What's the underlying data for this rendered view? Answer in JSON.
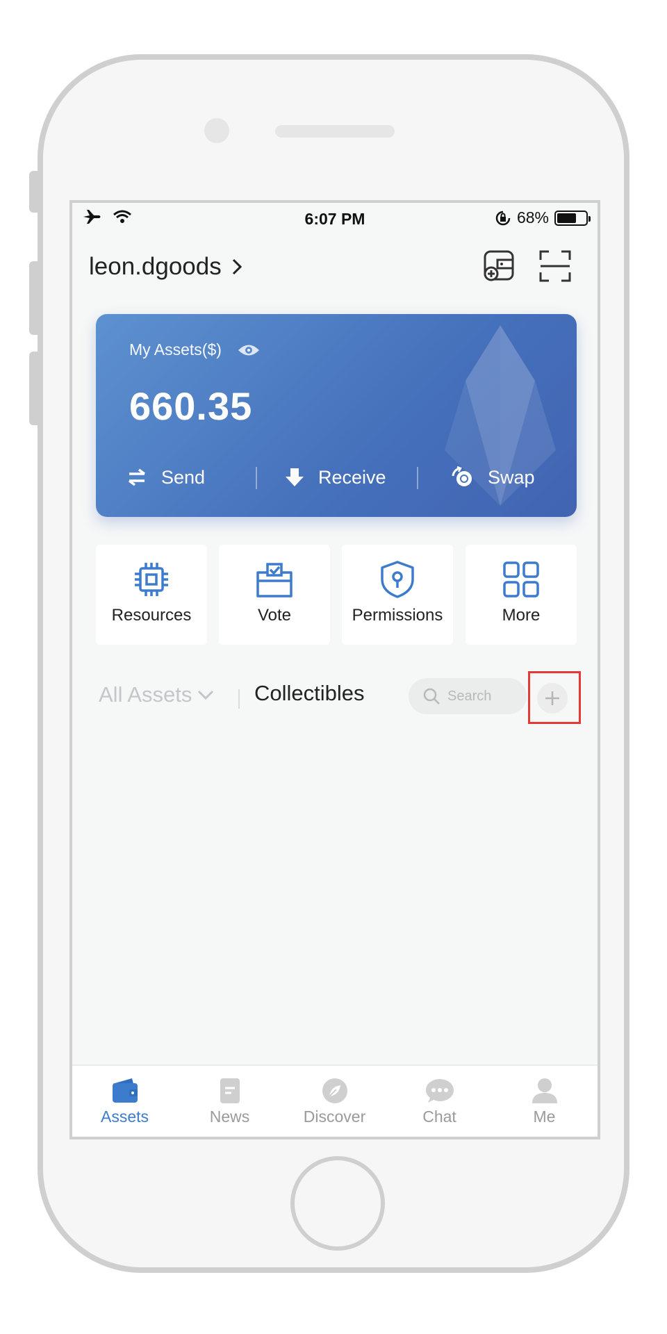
{
  "status_bar": {
    "time": "6:07 PM",
    "battery_percent": "68%",
    "battery_level": 0.68
  },
  "header": {
    "account_name": "leon.dgoods",
    "chevron": ">"
  },
  "card": {
    "label": "My Assets($)",
    "value": "660.35",
    "actions": [
      {
        "label": "Send",
        "icon": "swap-arrows-icon"
      },
      {
        "label": "Receive",
        "icon": "download-arrow-icon"
      },
      {
        "label": "Swap",
        "icon": "swap-coins-icon"
      }
    ]
  },
  "tiles": [
    {
      "label": "Resources",
      "icon": "chip-icon"
    },
    {
      "label": "Vote",
      "icon": "ballot-box-icon"
    },
    {
      "label": "Permissions",
      "icon": "shield-key-icon"
    },
    {
      "label": "More",
      "icon": "grid-icon"
    }
  ],
  "filter": {
    "all_assets": "All Assets",
    "collectibles": "Collectibles",
    "search_placeholder": "Search"
  },
  "tabbar": [
    {
      "label": "Assets",
      "icon": "wallet-icon",
      "active": true
    },
    {
      "label": "News",
      "icon": "document-icon",
      "active": false
    },
    {
      "label": "Discover",
      "icon": "compass-leaf-icon",
      "active": false
    },
    {
      "label": "Chat",
      "icon": "chat-bubble-icon",
      "active": false
    },
    {
      "label": "Me",
      "icon": "person-icon",
      "active": false
    }
  ],
  "colors": {
    "accent": "#3d7ccc",
    "card_start": "#5d91d0",
    "card_end": "#4264b2",
    "highlight": "#e53935"
  }
}
